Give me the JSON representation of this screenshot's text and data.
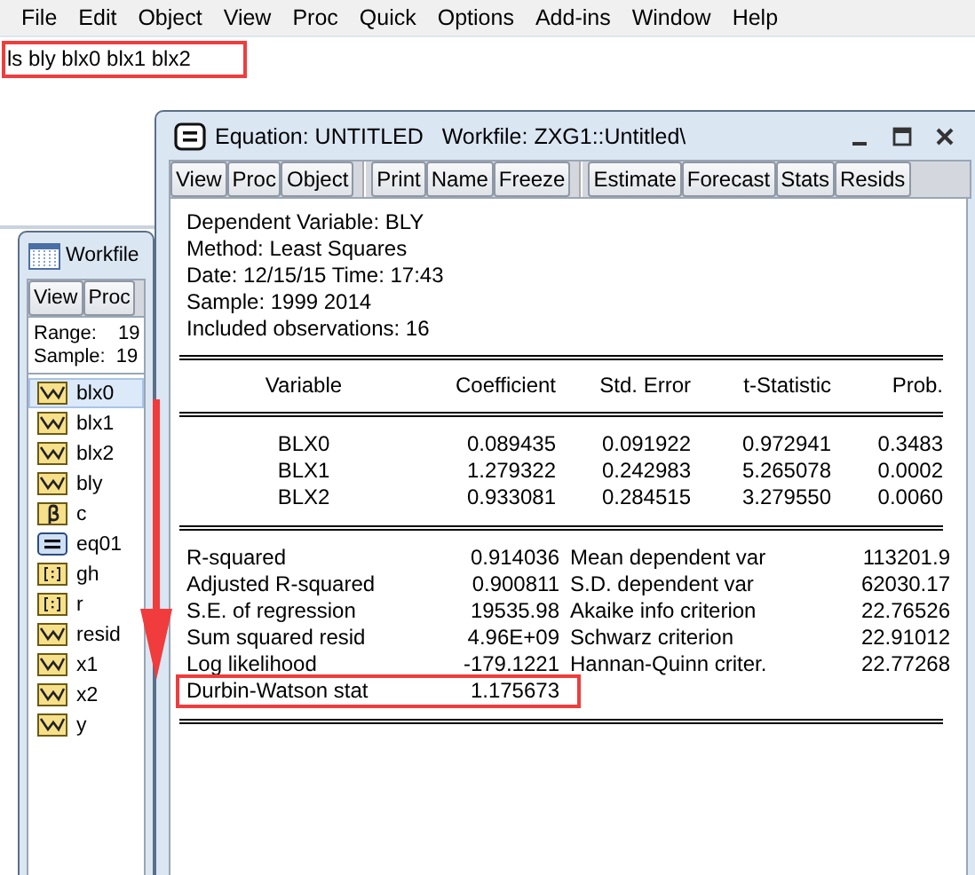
{
  "menu_bar": [
    "File",
    "Edit",
    "Object",
    "View",
    "Proc",
    "Quick",
    "Options",
    "Add-ins",
    "Window",
    "Help"
  ],
  "command": {
    "text": "ls bly blx0 blx1 blx2",
    "highlighted": true
  },
  "workfile_window": {
    "title": "Workfile",
    "toolbar": [
      "View",
      "Proc"
    ],
    "range_label": "Range:",
    "range_value": "19",
    "sample_label": "Sample:",
    "sample_value": "19",
    "objects": [
      {
        "name": "blx0",
        "kind": "series",
        "selected": true
      },
      {
        "name": "blx1",
        "kind": "series",
        "selected": false
      },
      {
        "name": "blx2",
        "kind": "series",
        "selected": false
      },
      {
        "name": "bly",
        "kind": "series",
        "selected": false
      },
      {
        "name": "c",
        "kind": "coef",
        "selected": false
      },
      {
        "name": "eq01",
        "kind": "equation",
        "selected": false
      },
      {
        "name": "gh",
        "kind": "vector",
        "selected": false
      },
      {
        "name": "r",
        "kind": "vector",
        "selected": false
      },
      {
        "name": "resid",
        "kind": "series",
        "selected": false
      },
      {
        "name": "x1",
        "kind": "series",
        "selected": false
      },
      {
        "name": "x2",
        "kind": "series",
        "selected": false
      },
      {
        "name": "y",
        "kind": "series",
        "selected": false
      }
    ]
  },
  "equation_window": {
    "title": "Equation: UNTITLED   Workfile: ZXG1::Untitled\\",
    "toolbar_groups": [
      [
        "View",
        "Proc",
        "Object"
      ],
      [
        "Print",
        "Name",
        "Freeze"
      ],
      [
        "Estimate",
        "Forecast",
        "Stats",
        "Resids"
      ]
    ],
    "header_lines": [
      "Dependent Variable: BLY",
      "Method: Least Squares",
      "Date: 12/15/15   Time: 17:43",
      "Sample: 1999 2014",
      "Included observations: 16"
    ],
    "table": {
      "columns": [
        "Variable",
        "Coefficient",
        "Std. Error",
        "t-Statistic",
        "Prob."
      ],
      "rows": [
        [
          "BLX0",
          "0.089435",
          "0.091922",
          "0.972941",
          "0.3483"
        ],
        [
          "BLX1",
          "1.279322",
          "0.242983",
          "5.265078",
          "0.0002"
        ],
        [
          "BLX2",
          "0.933081",
          "0.284515",
          "3.279550",
          "0.0060"
        ]
      ]
    },
    "stats": [
      {
        "label": "R-squared",
        "value": "0.914036",
        "label2": "Mean dependent var",
        "value2": "113201.9"
      },
      {
        "label": "Adjusted R-squared",
        "value": "0.900811",
        "label2": "S.D. dependent var",
        "value2": "62030.17"
      },
      {
        "label": "S.E. of regression",
        "value": "19535.98",
        "label2": "Akaike info criterion",
        "value2": "22.76526"
      },
      {
        "label": "Sum squared resid",
        "value": "4.96E+09",
        "label2": "Schwarz criterion",
        "value2": "22.91012"
      },
      {
        "label": "Log likelihood",
        "value": "-179.1221",
        "label2": "Hannan-Quinn criter.",
        "value2": "22.77268"
      },
      {
        "label": "Durbin-Watson stat",
        "value": "1.175673",
        "highlighted": true
      }
    ]
  }
}
